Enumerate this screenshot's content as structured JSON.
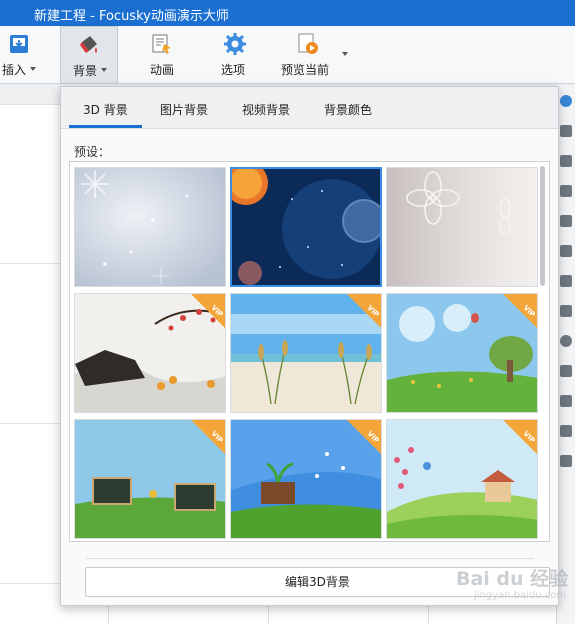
{
  "window": {
    "title": "新建工程 - Focusky动画演示大师"
  },
  "toolbar": {
    "items": [
      {
        "label": "插入",
        "icon": "insert-icon",
        "has_caret": true
      },
      {
        "label": "背景",
        "icon": "paint-bucket-icon",
        "has_caret": true,
        "active": true
      },
      {
        "label": "动画",
        "icon": "animation-icon",
        "has_caret": false
      },
      {
        "label": "选项",
        "icon": "gear-icon",
        "has_caret": false
      },
      {
        "label": "预览当前",
        "icon": "preview-play-icon",
        "has_caret": true
      }
    ]
  },
  "background_panel": {
    "tabs": [
      {
        "label": "3D 背景",
        "active": true
      },
      {
        "label": "图片背景",
        "active": false
      },
      {
        "label": "视频背景",
        "active": false
      },
      {
        "label": "背景颜色",
        "active": false
      }
    ],
    "preset_label": "预设：",
    "presets": [
      {
        "name": "snow-flakes",
        "vip": false,
        "selected": false
      },
      {
        "name": "space-planets",
        "vip": false,
        "selected": true
      },
      {
        "name": "flower-outline",
        "vip": false,
        "selected": false
      },
      {
        "name": "ink-landscape",
        "vip": true,
        "selected": false
      },
      {
        "name": "beach-reeds",
        "vip": true,
        "selected": false
      },
      {
        "name": "spring-meadow",
        "vip": true,
        "selected": false
      },
      {
        "name": "chalkboard-field",
        "vip": true,
        "selected": false
      },
      {
        "name": "sprout-sky",
        "vip": true,
        "selected": false
      },
      {
        "name": "cartoon-house",
        "vip": true,
        "selected": false
      }
    ],
    "vip_badge": "VIP",
    "edit_button_label": "编辑3D背景"
  },
  "watermark": {
    "text": "Bai du 经验",
    "sub": "jingyan.baidu.com"
  },
  "colors": {
    "accent": "#1b6fd1",
    "vip": "#f3a53a"
  }
}
